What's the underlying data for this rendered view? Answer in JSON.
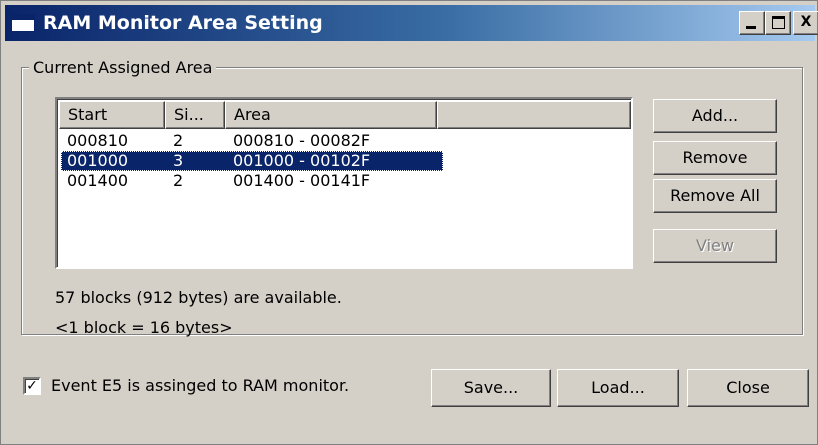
{
  "window": {
    "title": "RAM Monitor Area Setting",
    "controls": {
      "minimize": "_",
      "maximize": "□",
      "close": "X"
    }
  },
  "group": {
    "label": "Current Assigned Area"
  },
  "list": {
    "columns": [
      "Start",
      "Si...",
      "Area",
      ""
    ],
    "rows": [
      {
        "start": "000810",
        "size": "2",
        "area": "000810 - 00082F",
        "selected": false
      },
      {
        "start": "001000",
        "size": "3",
        "area": "001000 - 00102F",
        "selected": true
      },
      {
        "start": "001400",
        "size": "2",
        "area": "001400 - 00141F",
        "selected": false
      }
    ]
  },
  "side_buttons": {
    "add": "Add...",
    "remove": "Remove",
    "remove_all": "Remove All",
    "view": "View"
  },
  "info": {
    "available": "57 blocks (912 bytes) are available.",
    "block_size": "<1 block = 16 bytes>"
  },
  "event_checkbox": {
    "checked": true,
    "label": "Event E5 is assinged to RAM monitor."
  },
  "bottom_buttons": {
    "save": "Save...",
    "load": "Load...",
    "close": "Close"
  }
}
